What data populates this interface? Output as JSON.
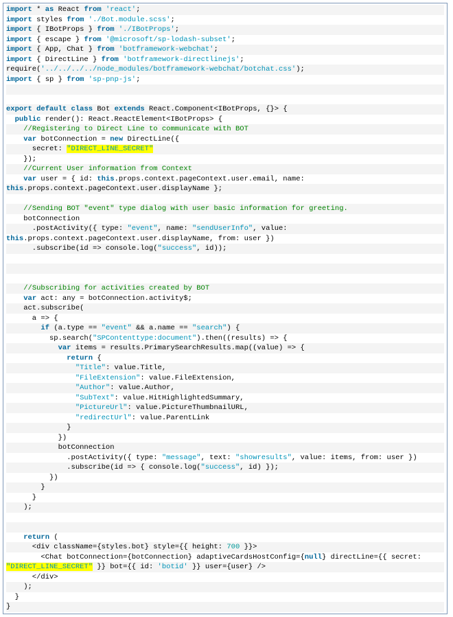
{
  "code": {
    "lines": [
      {
        "t": "importstar",
        "parts": [
          {
            "c": "kwb",
            "v": "import"
          },
          {
            "v": " * "
          },
          {
            "c": "kwb",
            "v": "as"
          },
          {
            "v": " React "
          },
          {
            "c": "kwb",
            "v": "from"
          },
          {
            "v": " "
          },
          {
            "c": "str",
            "v": "'react'"
          },
          {
            "v": ";"
          }
        ]
      },
      {
        "t": "importstyles",
        "parts": [
          {
            "c": "kwb",
            "v": "import"
          },
          {
            "v": " styles "
          },
          {
            "c": "kwb",
            "v": "from"
          },
          {
            "v": " "
          },
          {
            "c": "str",
            "v": "'./Bot.module.scss'"
          },
          {
            "v": ";"
          }
        ]
      },
      {
        "t": "importibot",
        "parts": [
          {
            "c": "kwb",
            "v": "import"
          },
          {
            "v": " { IBotProps } "
          },
          {
            "c": "kwb",
            "v": "from"
          },
          {
            "v": " "
          },
          {
            "c": "str",
            "v": "'./IBotProps'"
          },
          {
            "v": ";"
          }
        ]
      },
      {
        "t": "importescape",
        "parts": [
          {
            "c": "kwb",
            "v": "import"
          },
          {
            "v": " { escape } "
          },
          {
            "c": "kwb",
            "v": "from"
          },
          {
            "v": " "
          },
          {
            "c": "str",
            "v": "'@microsoft/sp-lodash-subset'"
          },
          {
            "v": ";"
          }
        ]
      },
      {
        "t": "importappchat",
        "parts": [
          {
            "c": "kwb",
            "v": "import"
          },
          {
            "v": " { App, Chat } "
          },
          {
            "c": "kwb",
            "v": "from"
          },
          {
            "v": " "
          },
          {
            "c": "str",
            "v": "'botframework-webchat'"
          },
          {
            "v": ";"
          }
        ]
      },
      {
        "t": "importdirectline",
        "parts": [
          {
            "c": "kwb",
            "v": "import"
          },
          {
            "v": " { DirectLine } "
          },
          {
            "c": "kwb",
            "v": "from"
          },
          {
            "v": " "
          },
          {
            "c": "str",
            "v": "'botframework-directlinejs'"
          },
          {
            "v": ";"
          }
        ]
      },
      {
        "t": "requirecss",
        "parts": [
          {
            "v": "require("
          },
          {
            "c": "str",
            "v": "'../../../../node_modules/botframework-webchat/botchat.css'"
          },
          {
            "v": ");"
          }
        ]
      },
      {
        "t": "importsp",
        "parts": [
          {
            "c": "kwb",
            "v": "import"
          },
          {
            "v": " { sp } "
          },
          {
            "c": "kwb",
            "v": "from"
          },
          {
            "v": " "
          },
          {
            "c": "str",
            "v": "'sp-pnp-js'"
          },
          {
            "v": ";"
          }
        ]
      },
      {
        "t": "blank1",
        "parts": [
          {
            "v": " "
          }
        ]
      },
      {
        "t": "blank2",
        "parts": [
          {
            "v": " "
          }
        ]
      },
      {
        "t": "classdecl",
        "parts": [
          {
            "c": "kwb",
            "v": "export"
          },
          {
            "v": " "
          },
          {
            "c": "kwb",
            "v": "default"
          },
          {
            "v": " "
          },
          {
            "c": "kwb",
            "v": "class"
          },
          {
            "v": " Bot "
          },
          {
            "c": "kwb",
            "v": "extends"
          },
          {
            "v": " React.Component<IBotProps, {}> {"
          }
        ]
      },
      {
        "t": "render",
        "parts": [
          {
            "v": "  "
          },
          {
            "c": "kwb",
            "v": "public"
          },
          {
            "v": " render(): React.ReactElement<IBotProps> {"
          }
        ]
      },
      {
        "t": "cmt1",
        "parts": [
          {
            "v": "    "
          },
          {
            "c": "cmt",
            "v": "//Registering to Direct Line to communicate with BOT"
          }
        ]
      },
      {
        "t": "botconn",
        "parts": [
          {
            "v": "    "
          },
          {
            "c": "kwb",
            "v": "var"
          },
          {
            "v": " botConnection = "
          },
          {
            "c": "kwb",
            "v": "new"
          },
          {
            "v": " DirectLine({"
          }
        ]
      },
      {
        "t": "secret",
        "parts": [
          {
            "v": "      secret: "
          },
          {
            "c": "str hl",
            "v": "\"DIRECT_LINE_SECRET\""
          }
        ]
      },
      {
        "t": "closeobj",
        "parts": [
          {
            "v": "    });"
          }
        ]
      },
      {
        "t": "cmt2",
        "parts": [
          {
            "v": "    "
          },
          {
            "c": "cmt",
            "v": "//Current User information from Context"
          }
        ]
      },
      {
        "t": "userdecl",
        "parts": [
          {
            "v": "    "
          },
          {
            "c": "kwb",
            "v": "var"
          },
          {
            "v": " user = { id: "
          },
          {
            "c": "kwb",
            "v": "this"
          },
          {
            "v": ".props.context.pageContext.user.email, name: "
          }
        ]
      },
      {
        "t": "userdecl2",
        "parts": [
          {
            "c": "kwb",
            "v": "this"
          },
          {
            "v": ".props.context.pageContext.user.displayName };"
          }
        ]
      },
      {
        "t": "blank3",
        "parts": [
          {
            "v": " "
          }
        ]
      },
      {
        "t": "cmt3",
        "parts": [
          {
            "v": "    "
          },
          {
            "c": "cmt",
            "v": "//Sending BOT \"event\" type dialog with user basic information for greeting."
          }
        ]
      },
      {
        "t": "botconnref",
        "parts": [
          {
            "v": "    botConnection"
          }
        ]
      },
      {
        "t": "postact1",
        "parts": [
          {
            "v": "      .postActivity({ type: "
          },
          {
            "c": "str",
            "v": "\"event\""
          },
          {
            "v": ", name: "
          },
          {
            "c": "str",
            "v": "\"sendUserInfo\""
          },
          {
            "v": ", value: "
          }
        ]
      },
      {
        "t": "postact2",
        "parts": [
          {
            "c": "kwb",
            "v": "this"
          },
          {
            "v": ".props.context.pageContext.user.displayName, from: user })"
          }
        ]
      },
      {
        "t": "subscribe1",
        "parts": [
          {
            "v": "      .subscribe(id => console.log("
          },
          {
            "c": "str",
            "v": "\"success\""
          },
          {
            "v": ", id));"
          }
        ]
      },
      {
        "t": "blank4",
        "parts": [
          {
            "v": " "
          }
        ]
      },
      {
        "t": "blank5",
        "parts": [
          {
            "v": " "
          }
        ]
      },
      {
        "t": "blank6",
        "parts": [
          {
            "v": " "
          }
        ]
      },
      {
        "t": "cmt4",
        "parts": [
          {
            "v": "    "
          },
          {
            "c": "cmt",
            "v": "//Subscribing for activities created by BOT"
          }
        ]
      },
      {
        "t": "actdecl",
        "parts": [
          {
            "v": "    "
          },
          {
            "c": "kwb",
            "v": "var"
          },
          {
            "v": " act: any = botConnection.activity$;"
          }
        ]
      },
      {
        "t": "actsub",
        "parts": [
          {
            "v": "    act.subscribe("
          }
        ]
      },
      {
        "t": "arrow",
        "parts": [
          {
            "v": "      a => {"
          }
        ]
      },
      {
        "t": "if",
        "parts": [
          {
            "v": "        "
          },
          {
            "c": "kwb",
            "v": "if"
          },
          {
            "v": " (a.type == "
          },
          {
            "c": "str",
            "v": "\"event\""
          },
          {
            "v": " && a.name == "
          },
          {
            "c": "str",
            "v": "\"search\""
          },
          {
            "v": ") {"
          }
        ]
      },
      {
        "t": "spsearch",
        "parts": [
          {
            "v": "          sp.search("
          },
          {
            "c": "str",
            "v": "\"SPContenttype:document\""
          },
          {
            "v": ").then((results) => {"
          }
        ]
      },
      {
        "t": "varitems",
        "parts": [
          {
            "v": "            "
          },
          {
            "c": "kwb",
            "v": "var"
          },
          {
            "v": " items = results.PrimarySearchResults.map((value) => {"
          }
        ]
      },
      {
        "t": "return1",
        "parts": [
          {
            "v": "              "
          },
          {
            "c": "kwb",
            "v": "return"
          },
          {
            "v": " {"
          }
        ]
      },
      {
        "t": "title",
        "parts": [
          {
            "v": "                "
          },
          {
            "c": "str",
            "v": "\"Title\""
          },
          {
            "v": ": value.Title,"
          }
        ]
      },
      {
        "t": "fileext",
        "parts": [
          {
            "v": "                "
          },
          {
            "c": "str",
            "v": "\"FileExtension\""
          },
          {
            "v": ": value.FileExtension,"
          }
        ]
      },
      {
        "t": "author",
        "parts": [
          {
            "v": "                "
          },
          {
            "c": "str",
            "v": "\"Author\""
          },
          {
            "v": ": value.Author,"
          }
        ]
      },
      {
        "t": "subtext",
        "parts": [
          {
            "v": "                "
          },
          {
            "c": "str",
            "v": "\"SubText\""
          },
          {
            "v": ": value.HitHighlightedSummary,"
          }
        ]
      },
      {
        "t": "picturl",
        "parts": [
          {
            "v": "                "
          },
          {
            "c": "str",
            "v": "\"PictureUrl\""
          },
          {
            "v": ": value.PictureThumbnailURL,"
          }
        ]
      },
      {
        "t": "redirect",
        "parts": [
          {
            "v": "                "
          },
          {
            "c": "str",
            "v": "\"redirectUrl\""
          },
          {
            "v": ": value.ParentLink"
          }
        ]
      },
      {
        "t": "closeret",
        "parts": [
          {
            "v": "              }"
          }
        ]
      },
      {
        "t": "closemap",
        "parts": [
          {
            "v": "            })"
          }
        ]
      },
      {
        "t": "botconn2",
        "parts": [
          {
            "v": "            botConnection"
          }
        ]
      },
      {
        "t": "postact3",
        "parts": [
          {
            "v": "              .postActivity({ type: "
          },
          {
            "c": "str",
            "v": "\"message\""
          },
          {
            "v": ", text: "
          },
          {
            "c": "str",
            "v": "\"showresults\""
          },
          {
            "v": ", value: items, from: user })"
          }
        ]
      },
      {
        "t": "subscribe2",
        "parts": [
          {
            "v": "              .subscribe(id => { console.log("
          },
          {
            "c": "str",
            "v": "\"success\""
          },
          {
            "v": ", id) });"
          }
        ]
      },
      {
        "t": "closethen",
        "parts": [
          {
            "v": "          })"
          }
        ]
      },
      {
        "t": "closeif",
        "parts": [
          {
            "v": "        }"
          }
        ]
      },
      {
        "t": "closearrow",
        "parts": [
          {
            "v": "      }"
          }
        ]
      },
      {
        "t": "closesub",
        "parts": [
          {
            "v": "    );"
          }
        ]
      },
      {
        "t": "blank7",
        "parts": [
          {
            "v": " "
          }
        ]
      },
      {
        "t": "blank8",
        "parts": [
          {
            "v": " "
          }
        ]
      },
      {
        "t": "return2",
        "parts": [
          {
            "v": "    "
          },
          {
            "c": "kwb",
            "v": "return"
          },
          {
            "v": " ("
          }
        ]
      },
      {
        "t": "div1",
        "parts": [
          {
            "v": "      <div className={styles.bot} style={{ height: "
          },
          {
            "c": "num",
            "v": "700"
          },
          {
            "v": " }}>"
          }
        ]
      },
      {
        "t": "chat",
        "parts": [
          {
            "v": "        <Chat botConnection={botConnection} adaptiveCardsHostConfig={"
          },
          {
            "c": "kwb",
            "v": "null"
          },
          {
            "v": "} directLine={{ secret: "
          }
        ]
      },
      {
        "t": "chat2",
        "parts": [
          {
            "c": "str hl",
            "v": "\"DIRECT_LINE_SECRET\""
          },
          {
            "v": " }} bot={{ id: "
          },
          {
            "c": "str",
            "v": "'botid'"
          },
          {
            "v": " }} user={user} />"
          }
        ]
      },
      {
        "t": "divclose",
        "parts": [
          {
            "v": "      </div>"
          }
        ]
      },
      {
        "t": "closereturn",
        "parts": [
          {
            "v": "    );"
          }
        ]
      },
      {
        "t": "closerender",
        "parts": [
          {
            "v": "  }"
          }
        ]
      },
      {
        "t": "closeclass",
        "parts": [
          {
            "v": "}"
          }
        ]
      }
    ]
  }
}
